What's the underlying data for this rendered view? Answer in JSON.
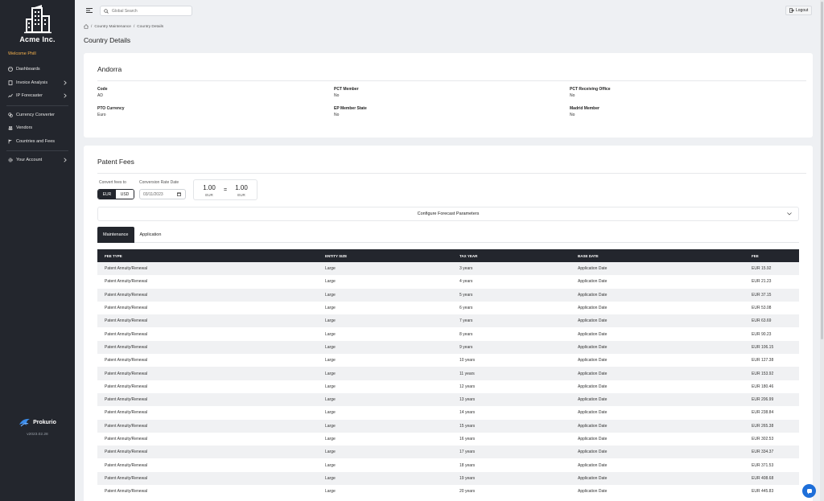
{
  "sidebar": {
    "brand": "Acme Inc.",
    "welcome": "Welcome Phill",
    "items": [
      {
        "label": "Dashboards",
        "icon": "palette-icon"
      },
      {
        "label": "Invoice Analysis",
        "icon": "document-icon"
      },
      {
        "label": "IP Forecaster",
        "icon": "chart-icon"
      },
      {
        "label": "Currency Converter",
        "icon": "exchange-icon"
      },
      {
        "label": "Vendors",
        "icon": "users-icon"
      },
      {
        "label": "Countries and Fees",
        "icon": "flag-icon"
      },
      {
        "label": "Your Account",
        "icon": "gear-icon"
      }
    ],
    "footer_brand": "Prokurio",
    "version": "v2023.02.28"
  },
  "topbar": {
    "search_placeholder": "Global Search",
    "logout_label": "Logout"
  },
  "breadcrumb": [
    "/",
    "Country Maintenance",
    "/",
    "Country Details"
  ],
  "page_title": "Country Details",
  "country": {
    "name": "Andorra",
    "fields": [
      {
        "label": "Code",
        "value": "AD"
      },
      {
        "label": "PCT Member",
        "value": "No"
      },
      {
        "label": "PCT Receiving Office",
        "value": "No"
      },
      {
        "label": "PTO Currency",
        "value": "Euro"
      },
      {
        "label": "EP Member State",
        "value": "No"
      },
      {
        "label": "Madrid Member",
        "value": "No"
      }
    ]
  },
  "fees": {
    "title": "Patent Fees",
    "convert_label": "Convert fees to",
    "currency_options": [
      "EUR",
      "USD"
    ],
    "selected_currency": "EUR",
    "rate_date_label": "Conversion Rate Date",
    "rate_date": "03/11/2023",
    "conversion": {
      "from_amount": "1.00",
      "from_currency": "EUR",
      "equals": "=",
      "to_amount": "1.00",
      "to_currency": "EUR"
    },
    "forecast_label": "Configure Forecast Parameters",
    "tabs": [
      "Maintenance",
      "Application"
    ],
    "active_tab": "Maintenance",
    "columns": [
      "FEE TYPE",
      "ENTITY SIZE",
      "TAX YEAR",
      "BASE DATE",
      "FEE"
    ],
    "rows": [
      [
        "Patent Annuity/Renewal",
        "Large",
        "3 years",
        "Application Date",
        "EUR 15.92"
      ],
      [
        "Patent Annuity/Renewal",
        "Large",
        "4 years",
        "Application Date",
        "EUR 21.23"
      ],
      [
        "Patent Annuity/Renewal",
        "Large",
        "5 years",
        "Application Date",
        "EUR 37.15"
      ],
      [
        "Patent Annuity/Renewal",
        "Large",
        "6 years",
        "Application Date",
        "EUR 53.08"
      ],
      [
        "Patent Annuity/Renewal",
        "Large",
        "7 years",
        "Application Date",
        "EUR 63.69"
      ],
      [
        "Patent Annuity/Renewal",
        "Large",
        "8 years",
        "Application Date",
        "EUR 90.23"
      ],
      [
        "Patent Annuity/Renewal",
        "Large",
        "9 years",
        "Application Date",
        "EUR 106.15"
      ],
      [
        "Patent Annuity/Renewal",
        "Large",
        "10 years",
        "Application Date",
        "EUR 127.38"
      ],
      [
        "Patent Annuity/Renewal",
        "Large",
        "11 years",
        "Application Date",
        "EUR 153.92"
      ],
      [
        "Patent Annuity/Renewal",
        "Large",
        "12 years",
        "Application Date",
        "EUR 180.46"
      ],
      [
        "Patent Annuity/Renewal",
        "Large",
        "13 years",
        "Application Date",
        "EUR 206.99"
      ],
      [
        "Patent Annuity/Renewal",
        "Large",
        "14 years",
        "Application Date",
        "EUR 238.84"
      ],
      [
        "Patent Annuity/Renewal",
        "Large",
        "15 years",
        "Application Date",
        "EUR 265.38"
      ],
      [
        "Patent Annuity/Renewal",
        "Large",
        "16 years",
        "Application Date",
        "EUR 302.53"
      ],
      [
        "Patent Annuity/Renewal",
        "Large",
        "17 years",
        "Application Date",
        "EUR 334.37"
      ],
      [
        "Patent Annuity/Renewal",
        "Large",
        "18 years",
        "Application Date",
        "EUR 371.53"
      ],
      [
        "Patent Annuity/Renewal",
        "Large",
        "19 years",
        "Application Date",
        "EUR 408.68"
      ],
      [
        "Patent Annuity/Renewal",
        "Large",
        "20 years",
        "Application Date",
        "EUR 445.83"
      ]
    ]
  },
  "colors": {
    "sidebar_bg": "#23262d",
    "welcome": "#f5b14c",
    "chat": "#1e6fd9"
  }
}
